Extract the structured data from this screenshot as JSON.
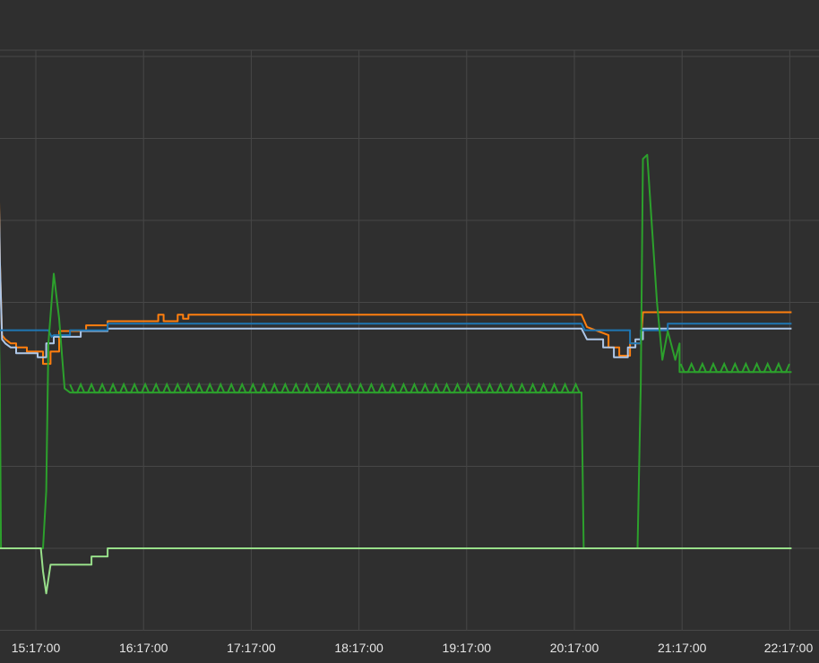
{
  "chart_data": {
    "type": "line",
    "title": "",
    "xlabel": "",
    "ylabel": "",
    "x_ticks": [
      "15:17:00",
      "16:17:00",
      "17:17:00",
      "18:17:00",
      "19:17:00",
      "20:17:00",
      "21:17:00",
      "22:17:00"
    ],
    "x_range_hours": [
      14.7,
      22.3
    ],
    "y_range": [
      -1,
      7
    ],
    "grid": true,
    "legend": "none",
    "series": [
      {
        "color": "#ff7f0e",
        "points": [
          [
            14.7,
            5.3
          ],
          [
            14.78,
            5.3
          ],
          [
            14.78,
            5.45
          ],
          [
            14.83,
            5.45
          ],
          [
            14.83,
            5.6
          ],
          [
            14.9,
            5.6
          ],
          [
            14.93,
            5.45
          ],
          [
            14.95,
            3.5
          ],
          [
            14.97,
            2.6
          ],
          [
            15.0,
            2.55
          ],
          [
            15.05,
            2.5
          ],
          [
            15.1,
            2.5
          ],
          [
            15.1,
            2.45
          ],
          [
            15.2,
            2.45
          ],
          [
            15.2,
            2.4
          ],
          [
            15.35,
            2.4
          ],
          [
            15.35,
            2.25
          ],
          [
            15.42,
            2.25
          ],
          [
            15.42,
            2.4
          ],
          [
            15.5,
            2.4
          ],
          [
            15.5,
            2.65
          ],
          [
            15.75,
            2.65
          ],
          [
            15.75,
            2.72
          ],
          [
            15.95,
            2.72
          ],
          [
            15.95,
            2.77
          ],
          [
            16.42,
            2.77
          ],
          [
            16.42,
            2.85
          ],
          [
            16.47,
            2.85
          ],
          [
            16.47,
            2.77
          ],
          [
            16.6,
            2.77
          ],
          [
            16.6,
            2.85
          ],
          [
            16.65,
            2.85
          ],
          [
            16.65,
            2.8
          ],
          [
            16.7,
            2.8
          ],
          [
            16.7,
            2.85
          ],
          [
            20.35,
            2.85
          ],
          [
            20.4,
            2.7
          ],
          [
            20.6,
            2.6
          ],
          [
            20.6,
            2.45
          ],
          [
            20.7,
            2.45
          ],
          [
            20.7,
            2.35
          ],
          [
            20.8,
            2.35
          ],
          [
            20.8,
            2.5
          ],
          [
            20.9,
            2.5
          ],
          [
            20.92,
            2.88
          ],
          [
            22.3,
            2.88
          ]
        ]
      },
      {
        "color": "#aec7e8",
        "points": [
          [
            14.7,
            5.0
          ],
          [
            14.75,
            5.0
          ],
          [
            14.75,
            5.07
          ],
          [
            14.8,
            5.07
          ],
          [
            14.8,
            5.15
          ],
          [
            14.85,
            5.15
          ],
          [
            14.85,
            5.23
          ],
          [
            14.93,
            5.23
          ],
          [
            14.95,
            3.5
          ],
          [
            14.97,
            2.55
          ],
          [
            15.0,
            2.5
          ],
          [
            15.05,
            2.45
          ],
          [
            15.1,
            2.45
          ],
          [
            15.1,
            2.38
          ],
          [
            15.3,
            2.38
          ],
          [
            15.3,
            2.33
          ],
          [
            15.38,
            2.33
          ],
          [
            15.38,
            2.5
          ],
          [
            15.45,
            2.5
          ],
          [
            15.45,
            2.58
          ],
          [
            15.7,
            2.58
          ],
          [
            15.7,
            2.65
          ],
          [
            15.95,
            2.65
          ],
          [
            15.95,
            2.68
          ],
          [
            20.35,
            2.68
          ],
          [
            20.4,
            2.55
          ],
          [
            20.55,
            2.55
          ],
          [
            20.55,
            2.45
          ],
          [
            20.65,
            2.45
          ],
          [
            20.65,
            2.33
          ],
          [
            20.78,
            2.33
          ],
          [
            20.78,
            2.45
          ],
          [
            20.85,
            2.45
          ],
          [
            20.85,
            2.55
          ],
          [
            20.92,
            2.55
          ],
          [
            20.92,
            2.68
          ],
          [
            22.3,
            2.68
          ]
        ]
      },
      {
        "color": "#1f77b4",
        "points": [
          [
            14.7,
            2.66
          ],
          [
            15.4,
            2.66
          ],
          [
            15.43,
            2.58
          ],
          [
            15.45,
            2.6
          ],
          [
            15.6,
            2.6
          ],
          [
            15.6,
            2.66
          ],
          [
            15.95,
            2.66
          ],
          [
            15.95,
            2.74
          ],
          [
            20.35,
            2.74
          ],
          [
            20.38,
            2.66
          ],
          [
            20.8,
            2.66
          ],
          [
            20.8,
            2.5
          ],
          [
            20.9,
            2.5
          ],
          [
            20.9,
            2.66
          ],
          [
            21.15,
            2.66
          ],
          [
            21.15,
            2.74
          ],
          [
            22.3,
            2.74
          ]
        ]
      },
      {
        "color": "#2ca02c",
        "points": [
          [
            14.7,
            3.5
          ],
          [
            14.93,
            3.5
          ],
          [
            14.95,
            2.0
          ],
          [
            14.96,
            0.0
          ],
          [
            15.35,
            0.0
          ],
          [
            15.38,
            0.7
          ],
          [
            15.4,
            2.5
          ],
          [
            15.45,
            3.35
          ],
          [
            15.5,
            2.8
          ],
          [
            15.55,
            1.95
          ],
          [
            15.6,
            1.9
          ],
          [
            20.35,
            1.9
          ],
          [
            20.37,
            0.0
          ],
          [
            20.87,
            0.0
          ],
          [
            20.9,
            2.0
          ],
          [
            20.92,
            4.75
          ],
          [
            20.96,
            4.8
          ],
          [
            21.0,
            4.0
          ],
          [
            21.05,
            3.0
          ],
          [
            21.1,
            2.3
          ],
          [
            21.15,
            2.65
          ],
          [
            21.22,
            2.3
          ],
          [
            21.26,
            2.5
          ],
          [
            21.26,
            2.15
          ],
          [
            22.3,
            2.15
          ]
        ]
      },
      {
        "color": "#98df8a",
        "points": [
          [
            14.7,
            0.0
          ],
          [
            15.33,
            0.0
          ],
          [
            15.35,
            -0.28
          ],
          [
            15.38,
            -0.55
          ],
          [
            15.42,
            -0.2
          ],
          [
            15.8,
            -0.2
          ],
          [
            15.8,
            -0.1
          ],
          [
            15.95,
            -0.1
          ],
          [
            15.95,
            0.0
          ],
          [
            22.3,
            0.0
          ]
        ]
      }
    ]
  }
}
